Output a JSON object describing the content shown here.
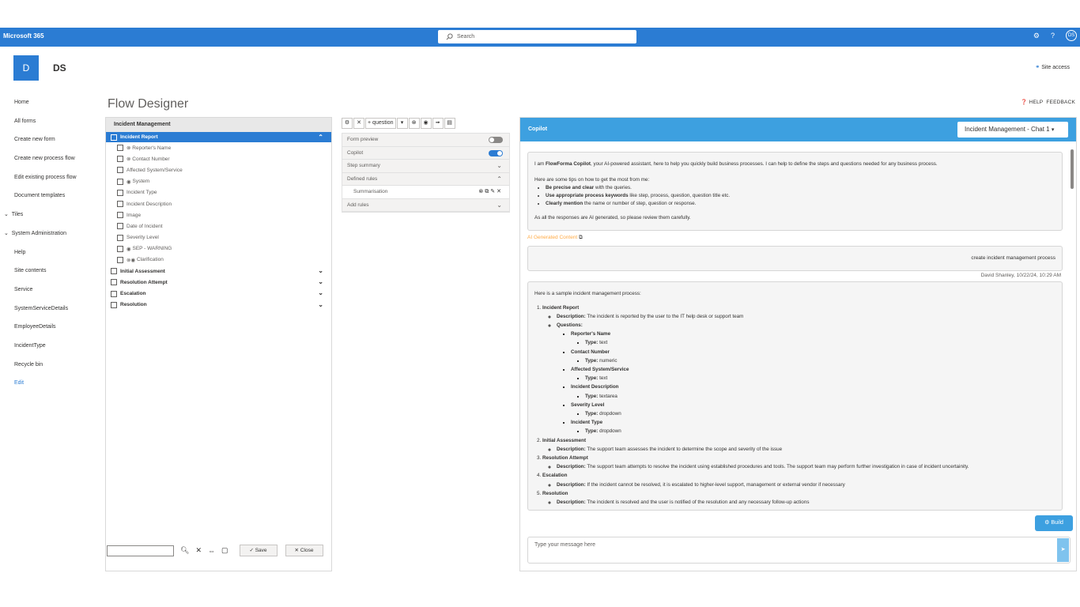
{
  "suite": {
    "brand": "Microsoft 365",
    "search_placeholder": "Search",
    "user_initials": "DS"
  },
  "site": {
    "logo_letter": "D",
    "name": "DS",
    "access": "Site access"
  },
  "nav": {
    "items": [
      "Home",
      "All forms",
      "Create new form",
      "Create new process flow",
      "Edit existing process flow",
      "Document templates",
      "Tiles",
      "System Administration",
      "Help",
      "Site contents",
      "Service",
      "SystemServiceDetails",
      "EmployeeDetails",
      "IncidentType",
      "Recycle bin",
      "Edit"
    ]
  },
  "page": {
    "title": "Flow Designer",
    "help": "HELP",
    "feedback": "FEEDBACK"
  },
  "tree": {
    "header": "Incident Management",
    "selected": "Incident Report",
    "children": [
      "Reporter's Name",
      "Contact Number",
      "Affected System/Service",
      "System",
      "Incident Type",
      "Incident Description",
      "Image",
      "Date of Incident",
      "Severity Level",
      "SEP - WARNING",
      "Clarification"
    ],
    "steps": [
      "Initial Assessment",
      "Resolution Attempt",
      "Escalation",
      "Resolution"
    ],
    "save": "Save",
    "close": "Close"
  },
  "toolbar": {
    "question": "question"
  },
  "mid": {
    "form_preview": "Form preview",
    "copilot": "Copilot",
    "step_summary": "Step summary",
    "defined_rules": "Defined rules",
    "rule": "Summarisation",
    "add_rules": "Add rules",
    "form_preview_on": false,
    "copilot_on": true
  },
  "copilot": {
    "title": "Copilot",
    "chat": "Incident Management - Chat 1",
    "intro_pre": "I am ",
    "intro_bold": "FlowForma Copilot",
    "intro_post": ", your AI-powered assistant, here to help you quickly build business processes. I can help to define the steps and questions needed for any business process.",
    "tips_header": "Here are some tips on how to get the most from me:",
    "tips": [
      {
        "b": "Be precise and clear",
        "t": " with the queries."
      },
      {
        "b": "Use appropriate process keywords",
        "t": " like step, process, question, question title etc."
      },
      {
        "b": "Clearly mention",
        "t": " the name or number of step, question or response."
      }
    ],
    "disclaimer": "As all the responses are AI generated, so please review them carefully.",
    "ai_label": "AI Generated Content",
    "user_msg": "create incident management process",
    "user_meta": "David Shanley, 10/22/24, 10:29 AM",
    "resp_intro": "Here is a sample incident management process:",
    "desc_label": "Description:",
    "questions_label": "Questions:",
    "type_label": "Type:",
    "steps": [
      {
        "name": "Incident Report",
        "desc": "The incident is reported by the user to the IT help desk or support team",
        "questions": [
          {
            "q": "Reporter's Name",
            "t": "text"
          },
          {
            "q": "Contact Number",
            "t": "numeric"
          },
          {
            "q": "Affected System/Service",
            "t": "text"
          },
          {
            "q": "Incident Description",
            "t": "textarea"
          },
          {
            "q": "Severity Level",
            "t": "dropdown"
          },
          {
            "q": "Incident Type",
            "t": "dropdown"
          }
        ]
      },
      {
        "name": "Initial Assessment",
        "desc": "The support team assesses the incident to determine the scope and severity of the issue"
      },
      {
        "name": "Resolution Attempt",
        "desc": "The support team attempts to resolve the incident using established procedures and tools. The support team may perform further investigation in case of incident uncertainity."
      },
      {
        "name": "Escalation",
        "desc": "If the incident cannot be resolved, it is escalated to higher-level support, management or external vendor if necessary"
      },
      {
        "name": "Resolution",
        "desc": "The incident is resolved and the user is notified of the resolution and any necessary follow-up actions"
      }
    ],
    "build": "Build",
    "input_placeholder": "Type your message here"
  }
}
